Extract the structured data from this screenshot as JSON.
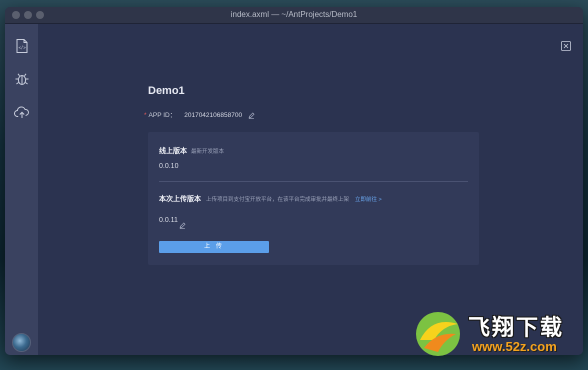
{
  "window": {
    "title": "index.axml — ~/AntProjects/Demo1"
  },
  "sidebar": {
    "items": [
      {
        "name": "file",
        "icon": "file-code-icon"
      },
      {
        "name": "debug",
        "icon": "bug-icon"
      },
      {
        "name": "upload",
        "icon": "cloud-upload-icon",
        "active": true
      }
    ]
  },
  "main": {
    "project_name": "Demo1",
    "app_id": {
      "required_mark": "*",
      "label": "APP ID：",
      "value": "2017042106858700"
    },
    "online": {
      "title": "线上版本",
      "desc": "最新开发版本",
      "version": "0.0.10"
    },
    "upload": {
      "title": "本次上传版本",
      "desc": "上传项目到支付宝开放平台，在该平台完成审批并最终上架",
      "link": "立即前往 >",
      "version": "0.0.11",
      "button_label": "上 传"
    }
  },
  "watermark": {
    "brand": "飞翔下载",
    "url": "www.52z.com"
  },
  "colors": {
    "window_bg": "#2b3350",
    "sidebar_bg": "#3a4260",
    "card_bg": "#323a59",
    "accent": "#5b9ee9",
    "link": "#6aa8f0"
  }
}
